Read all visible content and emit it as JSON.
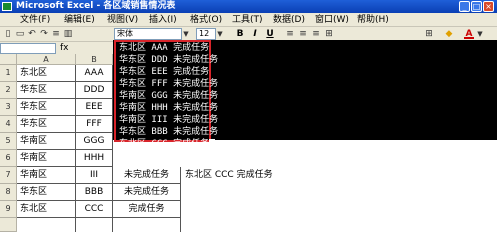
{
  "window": {
    "title": "Microsoft Excel - 各区域销售情况表"
  },
  "menu": [
    "文件(F)",
    "编辑(E)",
    "视图(V)",
    "插入(I)",
    "格式(O)",
    "工具(T)",
    "数据(D)",
    "窗口(W)",
    "帮助(H)"
  ],
  "toolbar": {
    "font": "宋体",
    "size": "12",
    "bold": "B",
    "italic": "I",
    "underline": "U",
    "font_color_icon": "A"
  },
  "formula": {
    "fx": "fx"
  },
  "columns": [
    "A",
    "B"
  ],
  "rows": [
    {
      "n": "1",
      "a": "东北区",
      "b": "AAA",
      "c": ""
    },
    {
      "n": "2",
      "a": "华东区",
      "b": "DDD",
      "c": ""
    },
    {
      "n": "3",
      "a": "华东区",
      "b": "EEE",
      "c": ""
    },
    {
      "n": "4",
      "a": "华东区",
      "b": "FFF",
      "c": ""
    },
    {
      "n": "5",
      "a": "华南区",
      "b": "GGG",
      "c": ""
    },
    {
      "n": "6",
      "a": "华南区",
      "b": "HHH",
      "c": ""
    },
    {
      "n": "7",
      "a": "华南区",
      "b": "III",
      "c": "未完成任务"
    },
    {
      "n": "8",
      "a": "华东区",
      "b": "BBB",
      "c": "未完成任务"
    },
    {
      "n": "9",
      "a": "东北区",
      "b": "CCC",
      "c": "完成任务"
    }
  ],
  "d7": "东北区 CCC 完成任务",
  "selection_lines": [
    "东北区 AAA 完成任务",
    "华东区 DDD 未完成任务",
    "华东区 EEE 完成任务",
    "华东区 FFF 未完成任务",
    "华南区 GGG 未完成任务",
    "华南区 HHH 未完成任务",
    "华南区 III 未完成任务",
    "华东区 BBB 未完成任务",
    "东北区 CCC 完成任务"
  ]
}
